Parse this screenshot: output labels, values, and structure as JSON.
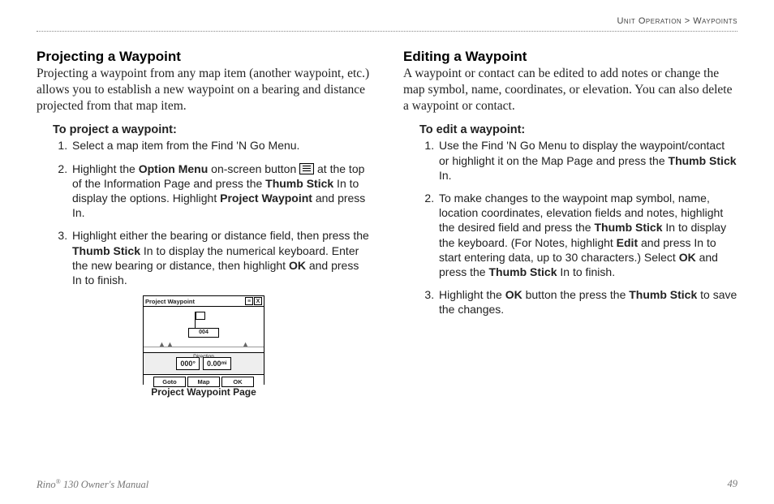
{
  "breadcrumb": {
    "section": "Unit Operation",
    "sep": " > ",
    "sub": "Waypoints"
  },
  "left": {
    "heading": "Projecting a Waypoint",
    "intro": "Projecting a waypoint from any map item (another waypoint, etc.) allows you to establish a new waypoint on a bearing and distance projected from that map item.",
    "subheading": "To project a waypoint:",
    "steps": {
      "s1": "Select a map item from the Find 'N Go Menu.",
      "s2a": "Highlight the ",
      "s2_b1": "Option Menu",
      "s2b": " on-screen button ",
      "s2c": " at the top of the Information Page and press the ",
      "s2_b2": "Thumb Stick",
      "s2d": " In to display the options. Highlight ",
      "s2_b3": "Project Waypoint",
      "s2e": " and press In.",
      "s3a": "Highlight either the bearing or distance field, then press the ",
      "s3_b1": "Thumb Stick",
      "s3b": " In to display the numerical keyboard. Enter the new bearing or distance, then highlight ",
      "s3_b2": "OK",
      "s3c": " and press In to finish."
    },
    "figure": {
      "titlebar": "Project Waypoint",
      "close": "X",
      "menu": "≡",
      "wp_label": "004",
      "direction_label": "Direction",
      "bearing": "000°",
      "distance": "0.00",
      "unit": "mi",
      "btn_goto": "Goto",
      "btn_map": "Map",
      "btn_ok": "OK",
      "caption": "Project Waypoint Page"
    }
  },
  "right": {
    "heading": "Editing a Waypoint",
    "intro": "A waypoint or contact can be edited to add notes or change the map symbol, name, coordinates, or elevation. You can also delete a waypoint or contact.",
    "subheading": "To edit a waypoint:",
    "steps": {
      "s1a": "Use the Find 'N Go Menu to display the waypoint/contact or highlight it on the Map Page and press the ",
      "s1_b1": "Thumb Stick",
      "s1b": " In.",
      "s2a": "To make changes to the waypoint map symbol, name, location coordinates, elevation fields and notes, highlight the desired field and press the ",
      "s2_b1": "Thumb Stick",
      "s2b": " In to display the keyboard. (For Notes, highlight ",
      "s2_b2": "Edit",
      "s2c": " and press In to start entering data, up to 30 characters.) Select ",
      "s2_b3": "OK",
      "s2d": " and press the ",
      "s2_b4": "Thumb Stick",
      "s2e": " In to finish.",
      "s3a": "Highlight the ",
      "s3_b1": "OK",
      "s3b": " button the press the ",
      "s3_b2": "Thumb Stick",
      "s3c": " to save the changes."
    }
  },
  "footer": {
    "product": "Rino",
    "reg": "®",
    "model": " 130 Owner's Manual",
    "page": "49"
  }
}
